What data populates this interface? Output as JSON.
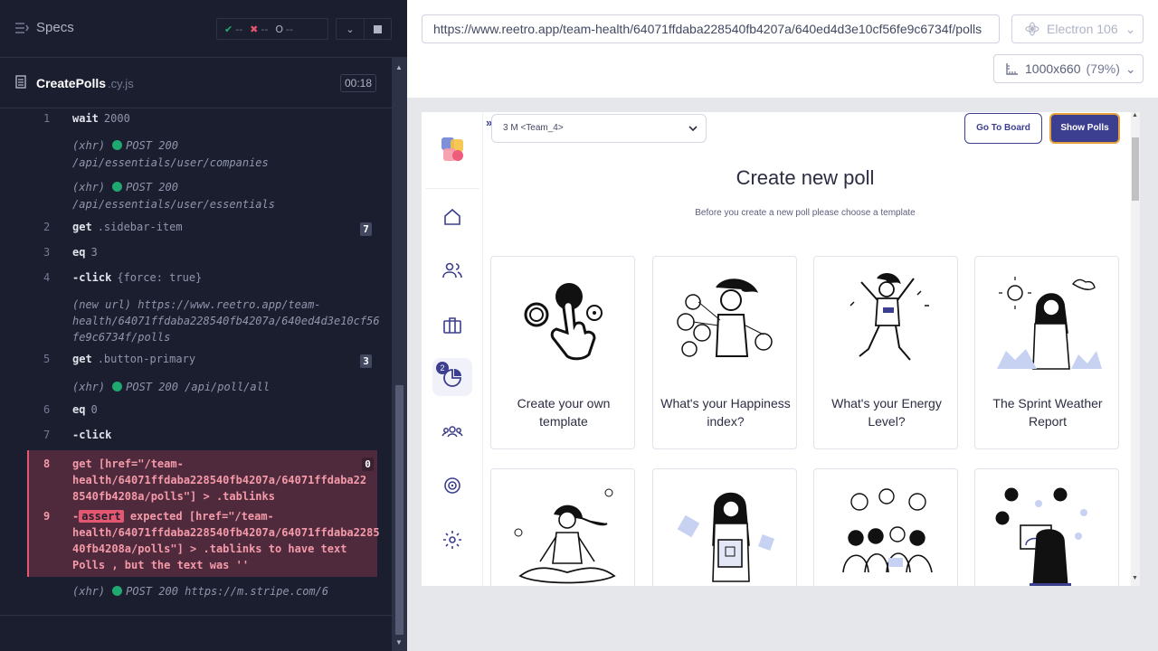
{
  "runner": {
    "title": "Specs",
    "stats": {
      "passed": "--",
      "failed": "--",
      "pending": "--"
    },
    "spec": {
      "name": "CreatePolls",
      "ext": ".cy.js",
      "time": "00:18"
    },
    "commands": [
      {
        "num": "1",
        "name": "wait",
        "arg": "2000"
      },
      {
        "sub": "(xhr)",
        "method": "POST 200",
        "url": "/api/essentials/user/companies"
      },
      {
        "sub": "(xhr)",
        "method": "POST 200",
        "url": "/api/essentials/user/essentials"
      },
      {
        "num": "2",
        "name": "get",
        "arg": ".sidebar-item",
        "badge": "7"
      },
      {
        "num": "3",
        "name": "eq",
        "arg": "3"
      },
      {
        "num": "4",
        "name": "-click",
        "arg": "{force: true}"
      },
      {
        "sub": "(new url)",
        "lines": [
          "(new url)  https://www.reetro.app/team-",
          "health/64071ffdaba228540fb4207a/640ed4d3e10cf56",
          "fe9c6734f/polls"
        ]
      },
      {
        "num": "5",
        "name": "get",
        "arg": ".button-primary",
        "badge": "3"
      },
      {
        "sub": "(xhr)",
        "method": "POST 200",
        "url": "/api/poll/all"
      },
      {
        "num": "6",
        "name": "eq",
        "arg": "0"
      },
      {
        "num": "7",
        "name": "-click",
        "arg": ""
      },
      {
        "num": "8",
        "lines": [
          "get  [href=\"/team-",
          "health/64071ffdaba228540fb4207a/64071ffdaba22",
          "8540fb4208a/polls\"] > .tablinks"
        ],
        "badge": "0"
      },
      {
        "num": "9",
        "pill": "assert",
        "lines": [
          "expected  [href=\"/team-",
          "health/64071ffdaba228540fb4207a/64071ffdaba2285",
          "40fb4208a/polls\"] > .tablinks  to have text",
          "Polls , but the text was  ''"
        ]
      },
      {
        "sub": "(xhr)",
        "method": "POST 200",
        "url": "https://m.stripe.com/6"
      }
    ]
  },
  "aut": {
    "url": "https://www.reetro.app/team-health/64071ffdaba228540fb4207a/640ed4d3e10cf56fe9c6734f/polls",
    "browser": "Electron 106",
    "viewport": "1000x660",
    "viewport_pct": "(79%)"
  },
  "app": {
    "team_select": "3 M <Team_4>",
    "go_to_board": "Go To Board",
    "show_polls": "Show Polls",
    "page_title": "Create new poll",
    "page_subtitle": "Before you create a new poll please choose a template",
    "nav_badge": "2",
    "cards": [
      {
        "label": "Create your own template"
      },
      {
        "label": "What's your Happiness index?"
      },
      {
        "label": "What's your Energy Level?"
      },
      {
        "label": "The Sprint Weather Report"
      },
      {
        "label": ""
      },
      {
        "label": ""
      },
      {
        "label": ""
      },
      {
        "label": ""
      }
    ]
  },
  "colors": {
    "runner_bg": "#1b1e2e",
    "fail_bg": "#4f2a3d",
    "fail_text": "#f59aa9",
    "pass_green": "#1fa971",
    "brand": "#3c3e8f",
    "accent_orange": "#e7a13a"
  }
}
